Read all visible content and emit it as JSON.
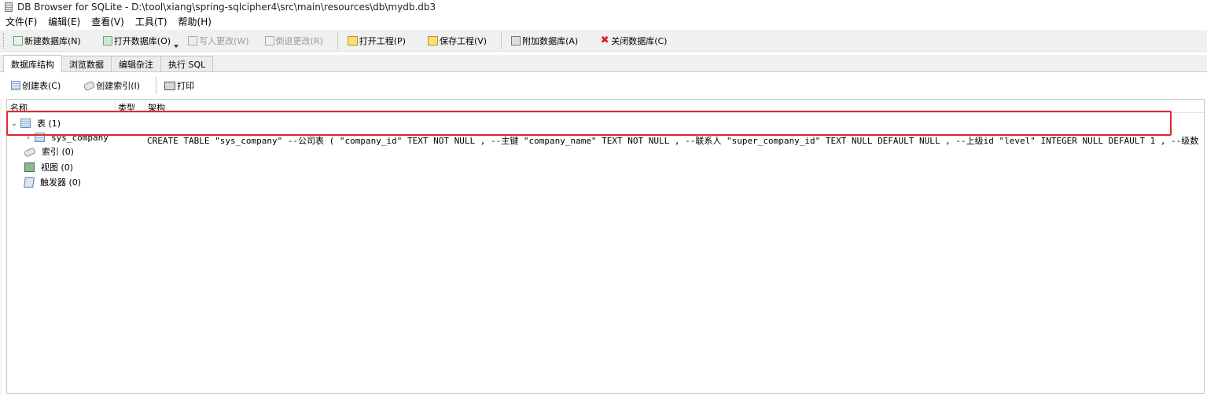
{
  "window": {
    "title": "DB Browser for SQLite - D:\\tool\\xiang\\spring-sqlcipher4\\src\\main\\resources\\db\\mydb.db3"
  },
  "menu": [
    "文件(F)",
    "编辑(E)",
    "查看(V)",
    "工具(T)",
    "帮助(H)"
  ],
  "toolbar": {
    "new_db": "新建数据库(N)",
    "open_db": "打开数据库(O)",
    "write_changes": "写入更改(W)",
    "revert_changes": "倒退更改(R)",
    "open_project": "打开工程(P)",
    "save_project": "保存工程(V)",
    "attach_db": "附加数据库(A)",
    "close_db": "关闭数据库(C)"
  },
  "tabs": [
    "数据库结构",
    "浏览数据",
    "编辑杂注",
    "执行 SQL"
  ],
  "structure_toolbar": {
    "create_table": "创建表(C)",
    "create_index": "创建索引(I)",
    "print": "打印"
  },
  "tree": {
    "headers": {
      "name": "名称",
      "type": "类型",
      "schema": "架构"
    },
    "tables": {
      "label": "表 (1)"
    },
    "table_row": {
      "name": "sys_company",
      "schema": "CREATE TABLE \"sys_company\" --公司表 ( \"company_id\" TEXT NOT NULL , --主键 \"company_name\" TEXT NOT NULL , --联系人 \"super_company_id\" TEXT NULL DEFAULT NULL , --上级id \"level\" INTEGER NULL DEFAULT 1 , --级数 \""
    },
    "indices": {
      "label": "索引 (0)"
    },
    "views": {
      "label": "视图 (0)"
    },
    "triggers": {
      "label": "触发器 (0)"
    }
  },
  "icons": {
    "app": "database-icon",
    "close_db": "red-x-icon"
  },
  "colors": {
    "highlight_border": "#e8262d"
  }
}
